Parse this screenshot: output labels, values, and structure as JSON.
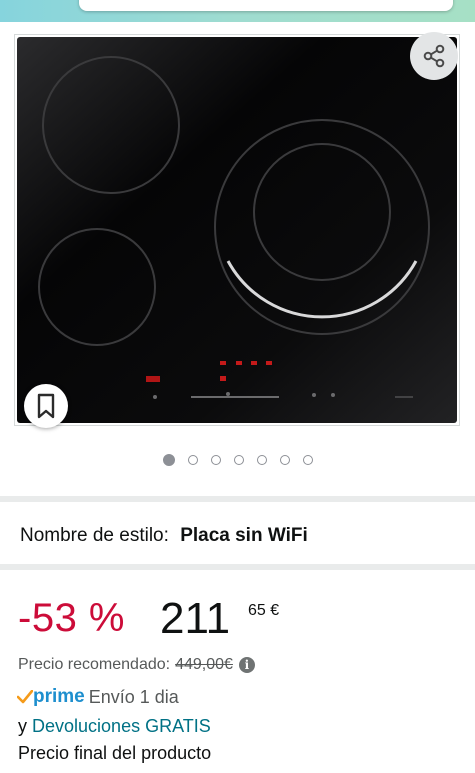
{
  "product": {
    "image_alt": "Placa de inducción negra con tres zonas de cocción",
    "gallery": {
      "total_images": 7,
      "active_index": 0
    },
    "share_icon": "share-icon",
    "save_icon": "bookmark-icon"
  },
  "style": {
    "label": "Nombre de estilo:",
    "value": "Placa sin WiFi"
  },
  "price": {
    "discount": "-53 %",
    "whole": "211",
    "fraction": "65 €",
    "list_label": "Precio recomendado:",
    "list_value": "449,00€",
    "info_icon": "i"
  },
  "delivery": {
    "prime_label": "prime",
    "shipping": "Envío 1 dia",
    "returns_prefix": "y",
    "returns_link": "Devoluciones GRATIS",
    "final_price_note": "Precio final del producto"
  },
  "colors": {
    "discount": "#cc0c39",
    "link": "#007185",
    "prime": "#1e8fce"
  }
}
